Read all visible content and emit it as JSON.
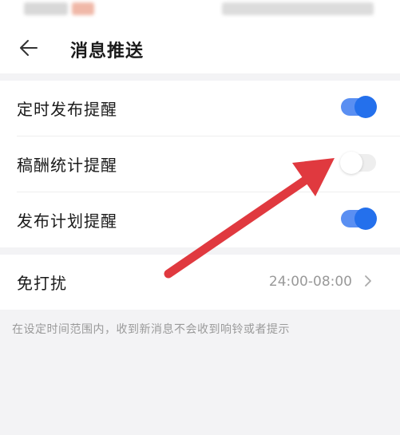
{
  "header": {
    "title": "消息推送"
  },
  "settings": [
    {
      "label": "定时发布提醒",
      "enabled": true
    },
    {
      "label": "稿酬统计提醒",
      "enabled": false
    },
    {
      "label": "发布计划提醒",
      "enabled": true
    }
  ],
  "dnd": {
    "label": "免打扰",
    "value": "24:00-08:00"
  },
  "note": "在设定时间范围内，收到新消息不会收到响铃或者提示",
  "colors": {
    "toggle_on": "#2470ec",
    "annotation_arrow": "#e0393f"
  }
}
